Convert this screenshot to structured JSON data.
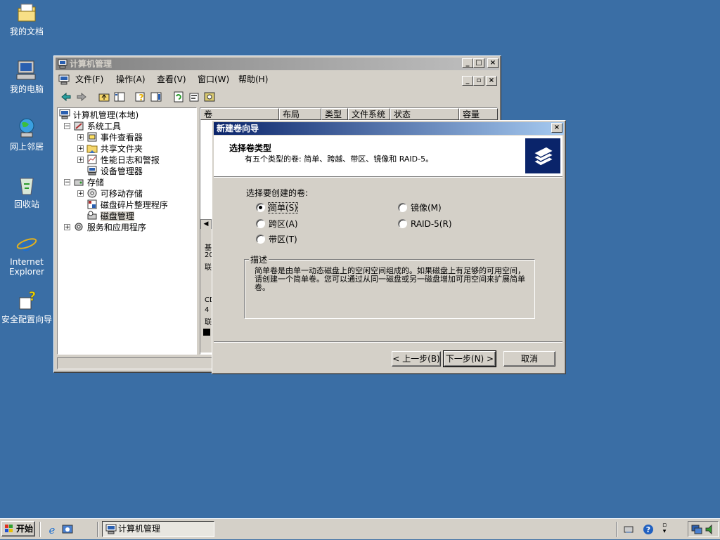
{
  "desktop": {
    "icons": [
      {
        "label": "我的文档",
        "icon": "my-documents-icon"
      },
      {
        "label": "我的电脑",
        "icon": "my-computer-icon"
      },
      {
        "label": "网上邻居",
        "icon": "network-places-icon"
      },
      {
        "label": "回收站",
        "icon": "recycle-bin-icon"
      },
      {
        "label": "Internet Explorer",
        "icon": "internet-explorer-icon"
      },
      {
        "label": "安全配置向导",
        "icon": "security-wizard-icon"
      }
    ]
  },
  "main_window": {
    "title": "计算机管理",
    "menu": [
      "文件(F)",
      "操作(A)",
      "查看(V)",
      "窗口(W)",
      "帮助(H)"
    ],
    "tree": {
      "root": "计算机管理(本地)",
      "items": [
        {
          "label": "系统工具",
          "level": 1,
          "expander": "−"
        },
        {
          "label": "事件查看器",
          "level": 2,
          "expander": "+"
        },
        {
          "label": "共享文件夹",
          "level": 2,
          "expander": "+"
        },
        {
          "label": "性能日志和警报",
          "level": 2,
          "expander": "+"
        },
        {
          "label": "设备管理器",
          "level": 2,
          "expander": ""
        },
        {
          "label": "存储",
          "level": 1,
          "expander": "−"
        },
        {
          "label": "可移动存储",
          "level": 2,
          "expander": "+"
        },
        {
          "label": "磁盘碎片整理程序",
          "level": 2,
          "expander": ""
        },
        {
          "label": "磁盘管理",
          "level": 2,
          "expander": ""
        },
        {
          "label": "服务和应用程序",
          "level": 1,
          "expander": "+"
        }
      ]
    },
    "columns": [
      "卷",
      "布局",
      "类型",
      "文件系统",
      "状态",
      "容量"
    ],
    "disk_panel_text": [
      "基",
      "20",
      "联",
      "CD",
      "4",
      "联"
    ]
  },
  "wizard": {
    "title": "新建卷向导",
    "heading": "选择卷类型",
    "subheading": "有五个类型的卷: 简单、跨越、带区、镜像和 RAID-5。",
    "select_label": "选择要创建的卷:",
    "options": [
      {
        "label": "简单(S)",
        "selected": true
      },
      {
        "label": "跨区(A)",
        "selected": false
      },
      {
        "label": "带区(T)",
        "selected": false
      },
      {
        "label": "镜像(M)",
        "selected": false
      },
      {
        "label": "RAID-5(R)",
        "selected": false
      }
    ],
    "description_label": "描述",
    "description": "简单卷是由单一动态磁盘上的空闲空间组成的。如果磁盘上有足够的可用空间，请创建一个简单卷。您可以通过从同一磁盘或另一磁盘增加可用空间来扩展简单卷。",
    "buttons": {
      "back": "< 上一步(B)",
      "next": "下一步(N) >",
      "cancel": "取消"
    }
  },
  "taskbar": {
    "start": "开始",
    "task": "计算机管理"
  },
  "colors": {
    "desktop": "#3a6ea5",
    "face": "#d4d0c8",
    "active_title": "#0a246a"
  }
}
